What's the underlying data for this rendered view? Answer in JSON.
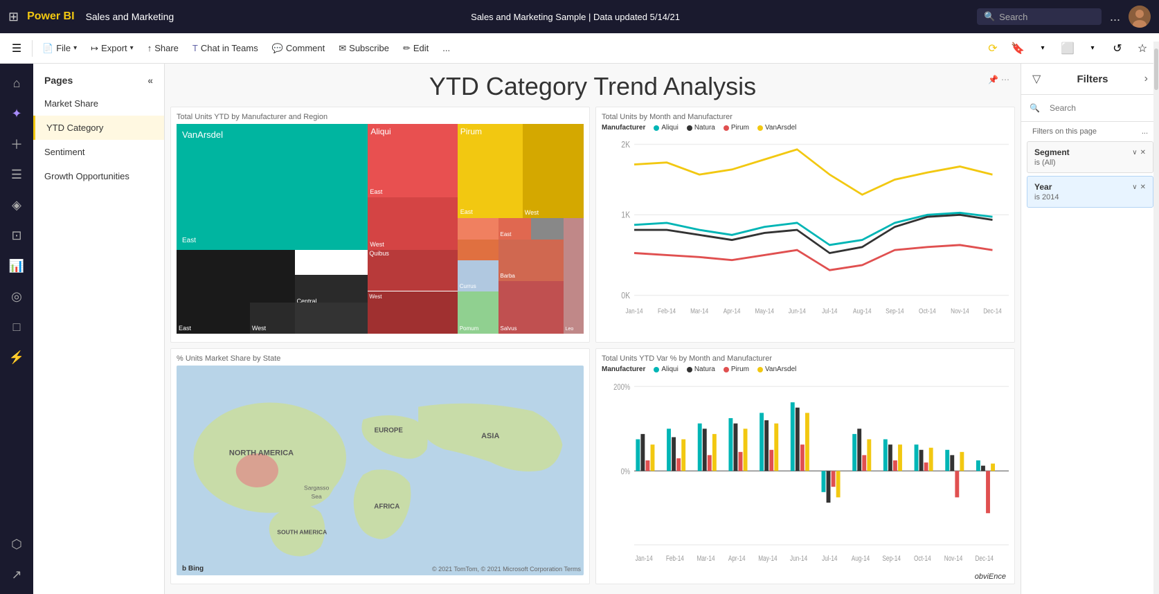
{
  "topbar": {
    "app_name": "Power BI",
    "workspace": "Sales and Marketing",
    "report_title": "Sales and Marketing Sample | Data updated 5/14/21",
    "search_placeholder": "Search",
    "dots_label": "...",
    "chevron_label": "∨"
  },
  "secondbar": {
    "file_label": "File",
    "export_label": "Export",
    "share_label": "Share",
    "chat_teams_label": "Chat in Teams",
    "comment_label": "Comment",
    "subscribe_label": "Subscribe",
    "edit_label": "Edit",
    "more_label": "..."
  },
  "pages_sidebar": {
    "header": "Pages",
    "items": [
      {
        "label": "Market Share",
        "active": false
      },
      {
        "label": "YTD Category",
        "active": true
      },
      {
        "label": "Sentiment",
        "active": false
      },
      {
        "label": "Growth Opportunities",
        "active": false
      }
    ]
  },
  "report": {
    "title": "YTD Category Trend Analysis"
  },
  "charts": {
    "treemap": {
      "title": "Total Units YTD by Manufacturer and Region"
    },
    "line_chart": {
      "title": "Total Units by Month and Manufacturer",
      "manufacturer_label": "Manufacturer",
      "legend": [
        {
          "name": "Aliqui",
          "color": "#00b5b5"
        },
        {
          "name": "Natura",
          "color": "#333333"
        },
        {
          "name": "Pirum",
          "color": "#e05050"
        },
        {
          "name": "VanArsdel",
          "color": "#f2c811"
        }
      ],
      "y_labels": [
        "2K",
        "1K",
        "0K"
      ],
      "x_labels": [
        "Jan-14",
        "Feb-14",
        "Mar-14",
        "Apr-14",
        "May-14",
        "Jun-14",
        "Jul-14",
        "Aug-14",
        "Sep-14",
        "Oct-14",
        "Nov-14",
        "Dec-14"
      ]
    },
    "map": {
      "title": "% Units Market Share by State",
      "labels": [
        "NORTH AMERICA",
        "EUROPE",
        "ASIA",
        "AFRICA",
        "SOUTH AMERICA"
      ],
      "sargasso_label": "Sargasso Sea",
      "bing_logo": "b Bing",
      "copyright": "© 2021 TomTom, © 2021 Microsoft Corporation Terms"
    },
    "bar_chart": {
      "title": "Total Units YTD Var % by Month and Manufacturer",
      "manufacturer_label": "Manufacturer",
      "legend": [
        {
          "name": "Aliqui",
          "color": "#00b5b5"
        },
        {
          "name": "Natura",
          "color": "#333333"
        },
        {
          "name": "Pirum",
          "color": "#e05050"
        },
        {
          "name": "VanArsdel",
          "color": "#f2c811"
        }
      ],
      "y_labels": [
        "200%",
        "0%"
      ],
      "x_labels": [
        "Jan-14",
        "Feb-14",
        "Mar-14",
        "Apr-14",
        "May-14",
        "Jun-14",
        "Jul-14",
        "Aug-14",
        "Sep-14",
        "Oct-14",
        "Nov-14",
        "Dec-14"
      ]
    }
  },
  "filters": {
    "title": "Filters",
    "search_placeholder": "Search",
    "section_label": "Filters on this page",
    "more_label": "...",
    "filter_cards": [
      {
        "name": "Segment",
        "value": "is (All)",
        "active": false
      },
      {
        "name": "Year",
        "value": "is 2014",
        "active": true
      }
    ]
  },
  "obviEnce": "obviEnce",
  "left_icons": [
    {
      "name": "home",
      "symbol": "⊞",
      "label": "home-icon"
    },
    {
      "name": "copilot",
      "symbol": "✦",
      "label": "copilot-icon"
    },
    {
      "name": "create",
      "symbol": "+",
      "label": "create-icon"
    },
    {
      "name": "browse",
      "symbol": "☰",
      "label": "browse-icon"
    },
    {
      "name": "onelake",
      "symbol": "◈",
      "label": "onelake-icon"
    },
    {
      "name": "apps",
      "symbol": "⊡",
      "label": "apps-icon"
    },
    {
      "name": "metrics",
      "symbol": "📊",
      "label": "metrics-icon"
    },
    {
      "name": "monitor",
      "symbol": "◉",
      "label": "monitor-icon"
    },
    {
      "name": "learn",
      "symbol": "□",
      "label": "learn-icon"
    },
    {
      "name": "real-time",
      "symbol": "⚡",
      "label": "realtime-icon"
    },
    {
      "name": "workspaces",
      "symbol": "⬡",
      "label": "workspaces-icon"
    },
    {
      "name": "nav",
      "symbol": "↗",
      "label": "nav-icon"
    }
  ]
}
